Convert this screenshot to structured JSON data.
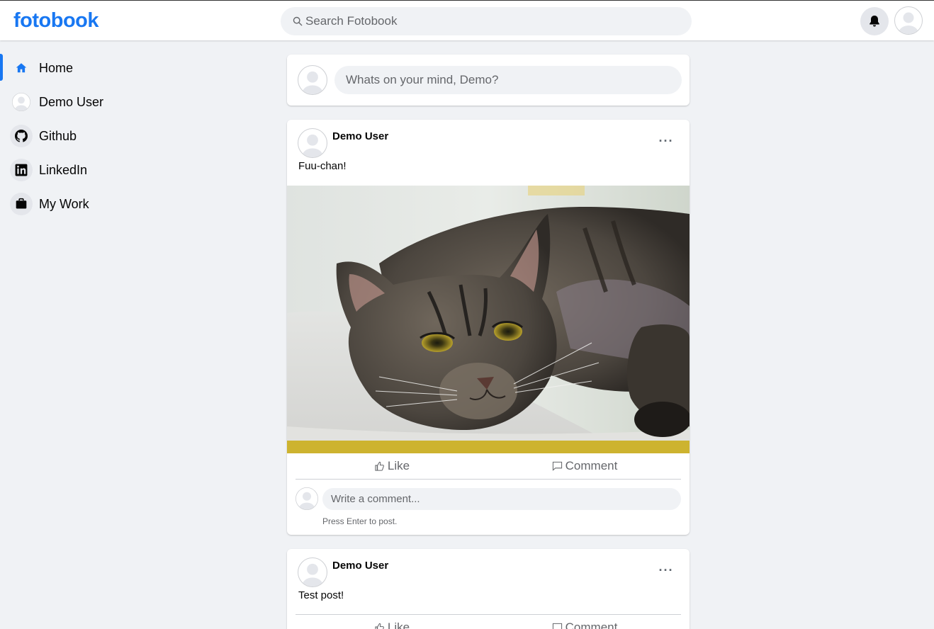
{
  "header": {
    "logo": "fotobook",
    "search_placeholder": "Search Fotobook"
  },
  "sidebar": {
    "items": [
      {
        "label": "Home",
        "icon": "home-icon",
        "active": true
      },
      {
        "label": "Demo User",
        "icon": "avatar"
      },
      {
        "label": "Github",
        "icon": "github-icon"
      },
      {
        "label": "LinkedIn",
        "icon": "linkedin-icon"
      },
      {
        "label": "My Work",
        "icon": "briefcase-icon"
      }
    ]
  },
  "composer": {
    "placeholder": "Whats on your mind, Demo?"
  },
  "posts": [
    {
      "author": "Demo User",
      "text": "Fuu-chan!",
      "has_image": true,
      "like_label": "Like",
      "comment_label": "Comment",
      "comment_placeholder": "Write a comment...",
      "comment_hint": "Press Enter to post."
    },
    {
      "author": "Demo User",
      "text": "Test post!",
      "like_label": "Like",
      "comment_label": "Comment"
    }
  ],
  "more_glyph": "···",
  "colors": {
    "brand": "#1877f2",
    "background": "#f0f2f5",
    "card": "#ffffff",
    "muted_text": "#65676b"
  }
}
